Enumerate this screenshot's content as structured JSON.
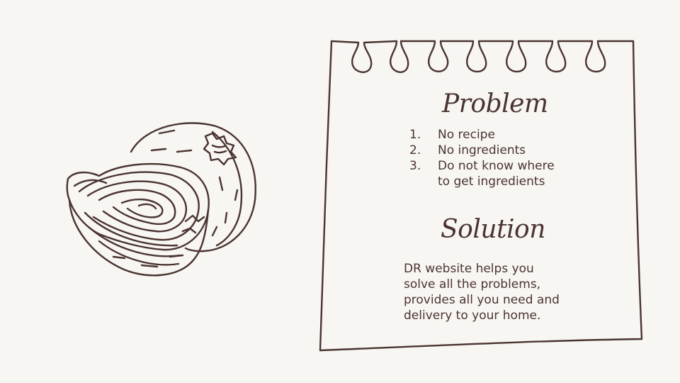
{
  "problem": {
    "title": "Problem",
    "items": [
      {
        "number": "1.",
        "text": "No recipe"
      },
      {
        "number": "2.",
        "text": "No ingredients"
      },
      {
        "number": "3.",
        "text": "Do not know where to get ingredients"
      }
    ]
  },
  "solution": {
    "title": "Solution",
    "text": "DR website helps you solve all the problems, provides all you need and delivery to your home."
  },
  "colors": {
    "background": "#f8f6f2",
    "ink": "#4a3431"
  },
  "icons": {
    "illustration": "onion-illustration-icon",
    "note": "torn-notebook-page"
  }
}
